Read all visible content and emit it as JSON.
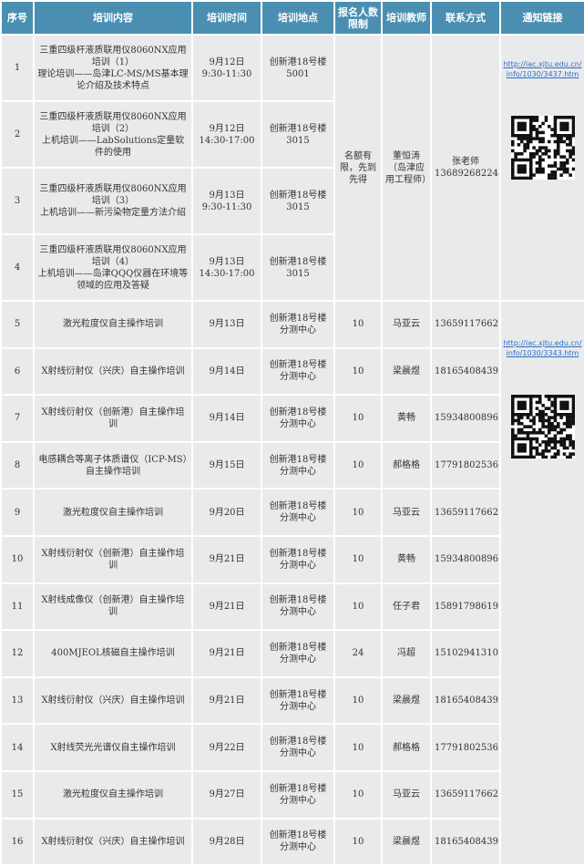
{
  "headers": [
    "序号",
    "培训内容",
    "培训时间",
    "培训地点",
    "报名人数限制",
    "培训教师",
    "联系方式",
    "通知链接"
  ],
  "group1": {
    "limit": "名额有限，先到先得",
    "teacher": "董恒涛（岛津应用工程师）",
    "contact": "张老师13689268224",
    "link": "http://iac.xjtu.edu.cn/info/1030/3437.htm",
    "rows": [
      {
        "no": "1",
        "content": [
          "三重四级杆液质联用仪8060NX应用培训（1）",
          "理论培训——岛津LC-MS/MS基本理论介绍及技术特点"
        ],
        "time": [
          "9月12日",
          "9:30-11:30"
        ],
        "place": "创新港18号楼5001"
      },
      {
        "no": "2",
        "content": [
          "三重四级杆液质联用仪8060NX应用培训（2）",
          "上机培训——LabSolutions定量软件的使用"
        ],
        "time": [
          "9月12日",
          "14:30-17:00"
        ],
        "place": "创新港18号楼3015"
      },
      {
        "no": "3",
        "content": [
          "三重四级杆液质联用仪8060NX应用培训（3）",
          "上机培训——新污染物定量方法介绍"
        ],
        "time": [
          "9月13日",
          "9:30-11:30"
        ],
        "place": "创新港18号楼3015"
      },
      {
        "no": "4",
        "content": [
          "三重四级杆液质联用仪8060NX应用培训（4）",
          "上机培训——岛津QQQ仪器在环境等领域的应用及答疑"
        ],
        "time": [
          "9月13日",
          "14:30-17:00"
        ],
        "place": "创新港18号楼3015"
      }
    ]
  },
  "group2": {
    "link": "http://iac.xjtu.edu.cn/info/1030/3343.htm",
    "rows": [
      {
        "no": "5",
        "content": "激光粒度仪自主操作培训",
        "time": "9月13日",
        "place": "创新港18号楼分测中心",
        "limit": "10",
        "teacher": "马亚云",
        "phone": "13659117662"
      },
      {
        "no": "6",
        "content": "X射线衍射仪（兴庆）自主操作培训",
        "time": "9月14日",
        "place": "创新港18号楼分测中心",
        "limit": "10",
        "teacher": "梁晨煜",
        "phone": "18165408439"
      },
      {
        "no": "7",
        "content": "X射线衍射仪（创新港）自主操作培训",
        "time": "9月14日",
        "place": "创新港18号楼分测中心",
        "limit": "10",
        "teacher": "黄畅",
        "phone": "15934800896"
      },
      {
        "no": "8",
        "content": "电感耦合等离子体质谱仪（ICP-MS）自主操作培训",
        "time": "9月15日",
        "place": "创新港18号楼分测中心",
        "limit": "10",
        "teacher": "郝格格",
        "phone": "17791802536"
      },
      {
        "no": "9",
        "content": "激光粒度仪自主操作培训",
        "time": "9月20日",
        "place": "创新港18号楼分测中心",
        "limit": "10",
        "teacher": "马亚云",
        "phone": "13659117662"
      },
      {
        "no": "10",
        "content": "X射线衍射仪（创新港）自主操作培训",
        "time": "9月21日",
        "place": "创新港18号楼分测中心",
        "limit": "10",
        "teacher": "黄畅",
        "phone": "15934800896"
      },
      {
        "no": "11",
        "content": "X射线成像仪（创新港）自主操作培训",
        "time": "9月21日",
        "place": "创新港18号楼分测中心",
        "limit": "10",
        "teacher": "任子君",
        "phone": "15891798619"
      },
      {
        "no": "12",
        "content": "400MJEOL核磁自主操作培训",
        "time": "9月21日",
        "place": "创新港18号楼分测中心",
        "limit": "24",
        "teacher": "冯超",
        "phone": "15102941310"
      },
      {
        "no": "13",
        "content": "X射线衍射仪（兴庆）自主操作培训",
        "time": "9月21日",
        "place": "创新港18号楼分测中心",
        "limit": "10",
        "teacher": "梁晨煜",
        "phone": "18165408439"
      },
      {
        "no": "14",
        "content": "X射线荧光光谱仪自主操作培训",
        "time": "9月22日",
        "place": "创新港18号楼分测中心",
        "limit": "10",
        "teacher": "郝格格",
        "phone": "17791802536"
      },
      {
        "no": "15",
        "content": "激光粒度仪自主操作培训",
        "time": "9月27日",
        "place": "创新港18号楼分测中心",
        "limit": "10",
        "teacher": "马亚云",
        "phone": "13659117662"
      },
      {
        "no": "16",
        "content": "X射线衍射仪（兴庆）自主操作培训",
        "time": "9月28日",
        "place": "创新港18号楼分测中心",
        "limit": "10",
        "teacher": "梁晨煜",
        "phone": "18165408439"
      }
    ]
  },
  "colors": {
    "header_bg": "#4a8fb2",
    "cell_bg": "#e9eaeb",
    "link": "#2a6fc9"
  }
}
